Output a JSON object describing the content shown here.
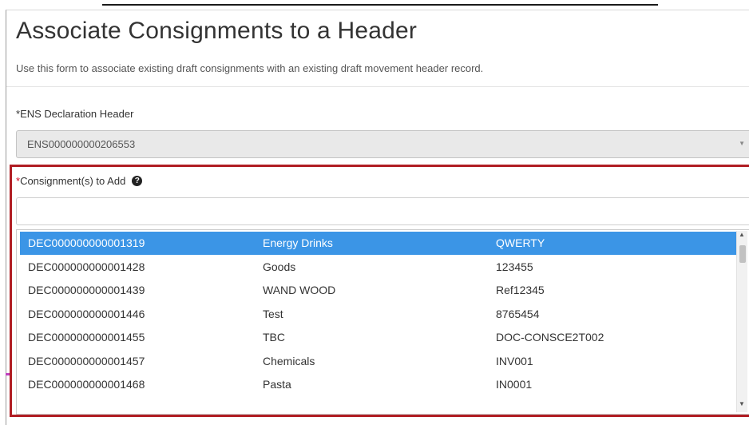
{
  "page": {
    "title": "Associate Consignments to a Header",
    "description": "Use this form to associate existing draft consignments with an existing draft movement header record."
  },
  "ens_field": {
    "required_marker": "*",
    "label": "ENS Declaration Header",
    "value": "ENS000000000206553",
    "caret_icon": "chevron-down-icon"
  },
  "consignments_field": {
    "required_marker": "*",
    "label": "Consignment(s) to Add",
    "help_icon": "question-circle-icon",
    "help_glyph": "?",
    "search_value": "",
    "options": [
      {
        "id": "DEC000000000001319",
        "description": "Energy Drinks",
        "reference": "QWERTY",
        "selected": true
      },
      {
        "id": "DEC000000000001428",
        "description": "Goods",
        "reference": "123455",
        "selected": false
      },
      {
        "id": "DEC000000000001439",
        "description": "WAND WOOD",
        "reference": "Ref12345",
        "selected": false
      },
      {
        "id": "DEC000000000001446",
        "description": "Test",
        "reference": "8765454",
        "selected": false
      },
      {
        "id": "DEC000000000001455",
        "description": "TBC",
        "reference": "DOC-CONSCE2T002",
        "selected": false
      },
      {
        "id": "DEC000000000001457",
        "description": "Chemicals",
        "reference": "INV001",
        "selected": false
      },
      {
        "id": "DEC000000000001468",
        "description": "Pasta",
        "reference": "IN0001",
        "selected": false
      }
    ]
  },
  "colors": {
    "selected_row": "#3b95e6",
    "required_red": "#d0021b",
    "highlight_border": "#b01d23"
  }
}
